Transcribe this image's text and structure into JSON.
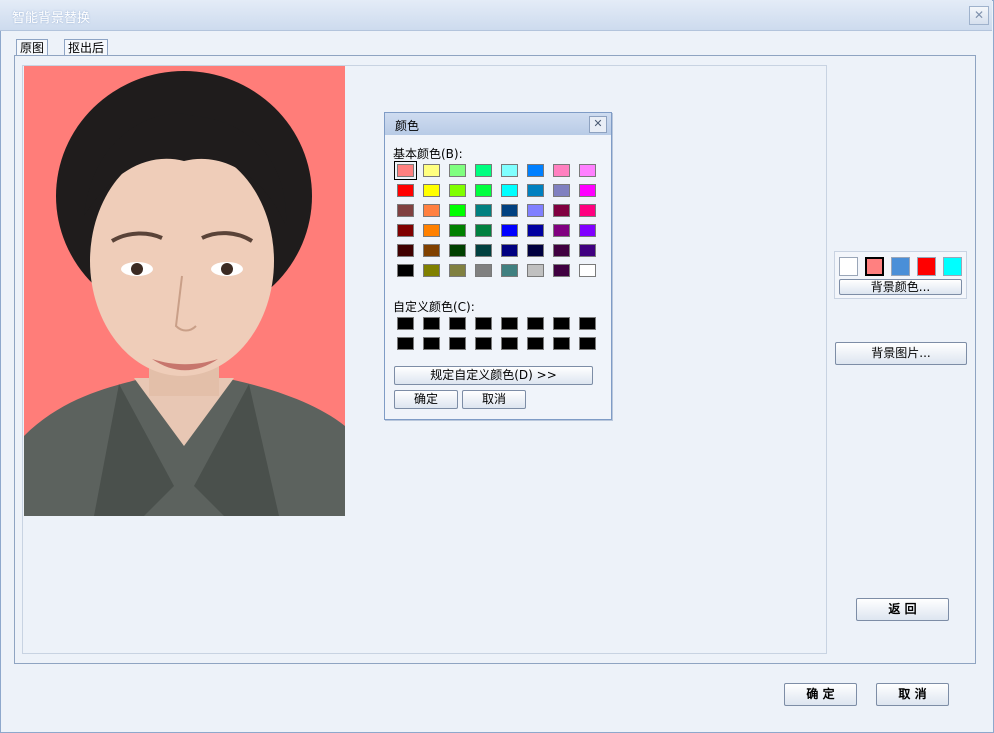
{
  "window": {
    "title": "智能背景替换"
  },
  "tabs": [
    {
      "label": "原图"
    },
    {
      "label": "抠出后"
    }
  ],
  "color_dialog": {
    "title": "颜色",
    "basic_label": "基本颜色(B):",
    "custom_label": "自定义颜色(C):",
    "define_custom_label": "规定自定义颜色(D) >>",
    "ok_label": "确定",
    "cancel_label": "取消",
    "basic_colors": [
      [
        "#ff8080",
        "#ffff80",
        "#80ff80",
        "#00ff80",
        "#80ffff",
        "#0080ff",
        "#ff80c0",
        "#ff80ff"
      ],
      [
        "#ff0000",
        "#ffff00",
        "#80ff00",
        "#00ff40",
        "#00ffff",
        "#0080c0",
        "#8080c0",
        "#ff00ff"
      ],
      [
        "#804040",
        "#ff8040",
        "#00ff00",
        "#008080",
        "#004080",
        "#8080ff",
        "#800040",
        "#ff0080"
      ],
      [
        "#800000",
        "#ff8000",
        "#008000",
        "#008040",
        "#0000ff",
        "#0000a0",
        "#800080",
        "#8000ff"
      ],
      [
        "#400000",
        "#804000",
        "#004000",
        "#004040",
        "#000080",
        "#000040",
        "#400040",
        "#400080"
      ],
      [
        "#000000",
        "#808000",
        "#808040",
        "#808080",
        "#408080",
        "#c0c0c0",
        "#400040",
        "#ffffff"
      ]
    ],
    "selected_color": "#ff8080",
    "custom_colors": [
      [
        "#000000",
        "#000000",
        "#000000",
        "#000000",
        "#000000",
        "#000000",
        "#000000",
        "#000000"
      ],
      [
        "#000000",
        "#000000",
        "#000000",
        "#000000",
        "#000000",
        "#000000",
        "#000000",
        "#000000"
      ]
    ]
  },
  "background_colors": [
    "#ffffff",
    "#ff8080",
    "#4a8fd8",
    "#ff0000",
    "#00ffff"
  ],
  "selected_background": "#ff8080",
  "buttons": {
    "bg_color": "背景颜色...",
    "bg_image": "背景图片...",
    "back": "返  回",
    "ok": "确  定",
    "cancel": "取  消"
  },
  "photo_background": "#ff7d79"
}
